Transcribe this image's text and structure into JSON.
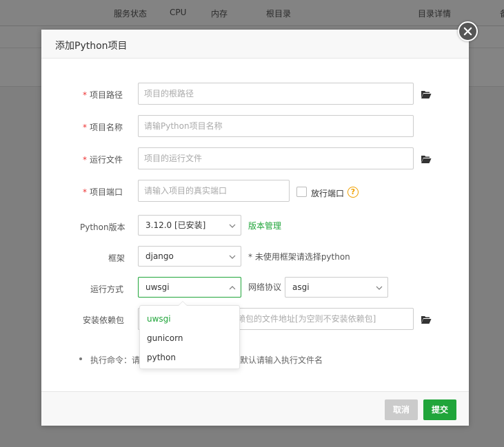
{
  "background": {
    "columns": [
      "服务状态",
      "CPU",
      "内存",
      "根目录",
      "目录详情",
      "备"
    ]
  },
  "modal": {
    "title": "添加Python项目",
    "fields": {
      "project_path": {
        "label": "项目路径",
        "placeholder": "项目的根路径",
        "required": true
      },
      "project_name": {
        "label": "项目名称",
        "placeholder": "请输Python项目名称",
        "required": true
      },
      "run_file": {
        "label": "运行文件",
        "placeholder": "项目的运行文件",
        "required": true
      },
      "project_port": {
        "label": "项目端口",
        "placeholder": "请输入项目的真实端口",
        "required": true
      },
      "open_port_label": "放行端口",
      "python_version": {
        "label": "Python版本",
        "value": "3.12.0 [已安装]"
      },
      "version_manage_link": "版本管理",
      "framework": {
        "label": "框架",
        "value": "django"
      },
      "framework_hint": "* 未使用框架请选择python",
      "run_mode": {
        "label": "运行方式",
        "value": "uwsgi",
        "options": [
          "uwsgi",
          "gunicorn",
          "python"
        ]
      },
      "protocol": {
        "label": "网络协议",
        "value": "asgi"
      },
      "install_deps": {
        "label": "安装依赖包",
        "placeholder_visible": "赖包的文件地址[为空则不安装依赖包]"
      }
    },
    "exec_cmd": {
      "prefix": "执行命令：请",
      "suffix": "默认请输入执行文件名"
    },
    "buttons": {
      "cancel": "取消",
      "submit": "提交"
    }
  },
  "colors": {
    "accent": "#20a53a",
    "required": "#ee3333",
    "help": "#f0a000"
  },
  "icons": {
    "close": "close-icon",
    "folder": "folder-open-icon",
    "caret_down": "chevron-down-icon",
    "caret_up": "chevron-up-icon",
    "help": "question-circle-icon"
  }
}
